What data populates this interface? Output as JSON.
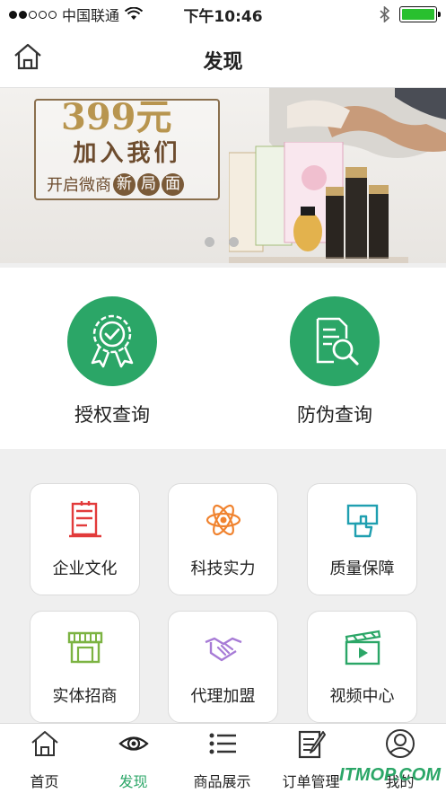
{
  "status": {
    "carrier": "中国联通",
    "time": "下午10:46"
  },
  "nav": {
    "title": "发现",
    "home_icon": "home-icon"
  },
  "banner": {
    "price": "399元",
    "join": "加入我们",
    "sub_prefix": "开启微商",
    "sub_chars": [
      "新",
      "局",
      "面"
    ],
    "pages": 2
  },
  "queries": [
    {
      "label": "授权查询",
      "icon": "certificate-icon"
    },
    {
      "label": "防伪查询",
      "icon": "document-search-icon"
    }
  ],
  "tiles": [
    {
      "label": "企业文化",
      "icon": "culture-icon",
      "color": "#e23b3b"
    },
    {
      "label": "科技实力",
      "icon": "atom-icon",
      "color": "#f0832f"
    },
    {
      "label": "质量保障",
      "icon": "quality-icon",
      "color": "#1f9fb0"
    },
    {
      "label": "实体招商",
      "icon": "store-icon",
      "color": "#7cb342"
    },
    {
      "label": "代理加盟",
      "icon": "handshake-icon",
      "color": "#a77bd6"
    },
    {
      "label": "视频中心",
      "icon": "video-icon",
      "color": "#2ba667"
    }
  ],
  "tabs": [
    {
      "label": "首页",
      "icon": "home-icon",
      "active": false
    },
    {
      "label": "发现",
      "icon": "eye-icon",
      "active": true
    },
    {
      "label": "商品展示",
      "icon": "list-icon",
      "active": false
    },
    {
      "label": "订单管理",
      "icon": "order-icon",
      "active": false
    },
    {
      "label": "我的",
      "icon": "user-icon",
      "active": false
    }
  ],
  "watermark": "ITMOP.COM",
  "colors": {
    "accent": "#2ba667",
    "battery": "#29c02f",
    "banner_brown": "#6d4c2e",
    "banner_gold": "#b8954f"
  }
}
